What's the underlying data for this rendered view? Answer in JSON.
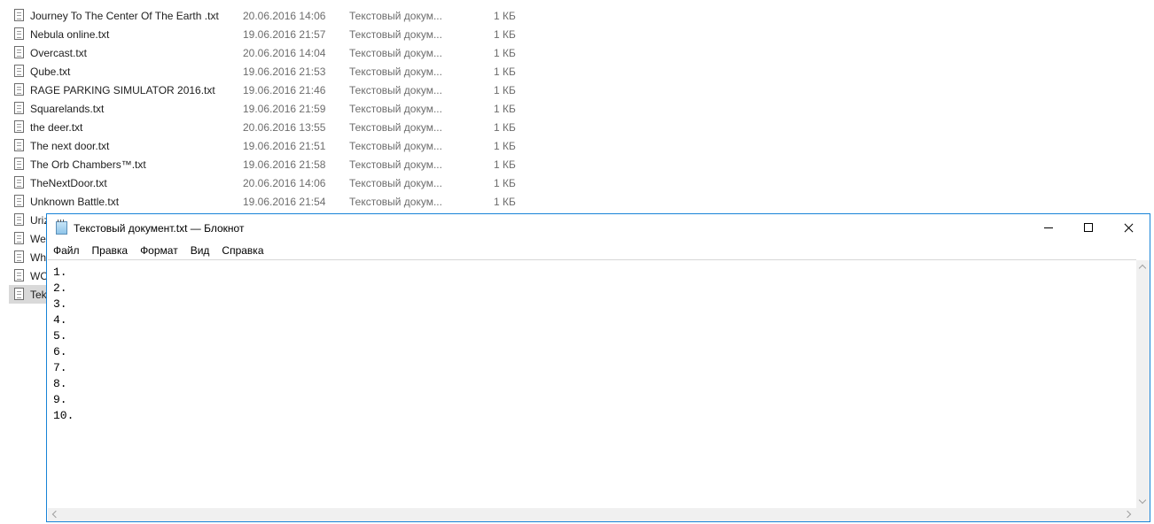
{
  "explorer": {
    "files": [
      {
        "name": "Journey To The Center Of The Earth .txt",
        "date": "20.06.2016 14:06",
        "type": "Текстовый докум...",
        "size": "1 КБ"
      },
      {
        "name": "Nebula online.txt",
        "date": "19.06.2016 21:57",
        "type": "Текстовый докум...",
        "size": "1 КБ"
      },
      {
        "name": "Overcast.txt",
        "date": "20.06.2016 14:04",
        "type": "Текстовый докум...",
        "size": "1 КБ"
      },
      {
        "name": "Qube.txt",
        "date": "19.06.2016 21:53",
        "type": "Текстовый докум...",
        "size": "1 КБ"
      },
      {
        "name": "RAGE PARKING SIMULATOR 2016.txt",
        "date": "19.06.2016 21:46",
        "type": "Текстовый докум...",
        "size": "1 КБ"
      },
      {
        "name": "Squarelands.txt",
        "date": "19.06.2016 21:59",
        "type": "Текстовый докум...",
        "size": "1 КБ"
      },
      {
        "name": "the deer.txt",
        "date": "20.06.2016 13:55",
        "type": "Текстовый докум...",
        "size": "1 КБ"
      },
      {
        "name": "The next door.txt",
        "date": "19.06.2016 21:51",
        "type": "Текстовый докум...",
        "size": "1 КБ"
      },
      {
        "name": "The Orb Chambers™.txt",
        "date": "19.06.2016 21:58",
        "type": "Текстовый докум...",
        "size": "1 КБ"
      },
      {
        "name": "TheNextDoor.txt",
        "date": "20.06.2016 14:06",
        "type": "Текстовый докум...",
        "size": "1 КБ"
      },
      {
        "name": "Unknown Battle.txt",
        "date": "19.06.2016 21:54",
        "type": "Текстовый докум...",
        "size": "1 КБ"
      }
    ],
    "partial_files": [
      "Uriz",
      "We",
      "Wh",
      "WO",
      "Tek"
    ]
  },
  "notepad": {
    "title": "Текстовый документ.txt — Блокнот",
    "menu": [
      "Файл",
      "Правка",
      "Формат",
      "Вид",
      "Справка"
    ],
    "lines": [
      "1.",
      "2.",
      "3.",
      "4.",
      "5.",
      "6.",
      "7.",
      "8.",
      "9.",
      "10."
    ]
  }
}
